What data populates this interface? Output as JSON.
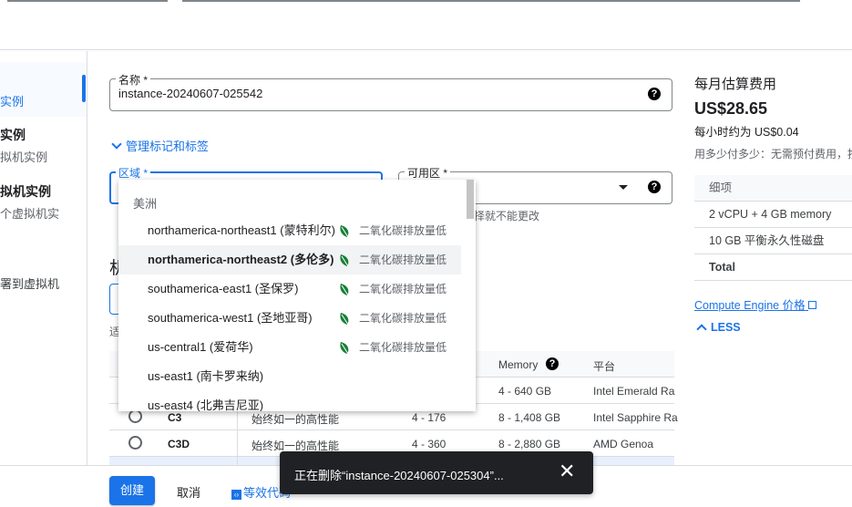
{
  "sidebar": {
    "items": [
      {
        "title": "",
        "subtitle": "实例"
      },
      {
        "title": "实例",
        "subtitle": "拟机实例"
      },
      {
        "title": "拟机实例",
        "subtitle": "个虚拟机实"
      },
      {
        "title": "",
        "subtitle": "署到虚拟机"
      }
    ]
  },
  "form": {
    "name_label": "名称 *",
    "name_value": "instance-20240607-025542",
    "manage_tags": "管理标记和标签",
    "region_label": "区域 *",
    "zone_label": "可用区 *",
    "zone_hint": "择就不能更改",
    "machine_heading_partial": "机",
    "hint_partial": "适"
  },
  "region_dropdown": {
    "group": "美洲",
    "items": [
      {
        "label": "northamerica-northeast1 (蒙特利尔)",
        "eco": "二氧化碳排放量低",
        "highlighted": false
      },
      {
        "label": "northamerica-northeast2 (多伦多)",
        "eco": "二氧化碳排放量低",
        "highlighted": true
      },
      {
        "label": "southamerica-east1 (圣保罗)",
        "eco": "二氧化碳排放量低",
        "highlighted": false
      },
      {
        "label": "southamerica-west1 (圣地亚哥)",
        "eco": "二氧化碳排放量低",
        "highlighted": false
      },
      {
        "label": "us-central1 (爱荷华)",
        "eco": "二氧化碳排放量低",
        "highlighted": false
      },
      {
        "label": "us-east1 (南卡罗来纳)",
        "eco": "",
        "highlighted": false
      },
      {
        "label": "us-east4 (北弗吉尼亚)",
        "eco": "",
        "highlighted": false
      }
    ],
    "leaf_color": "#188038"
  },
  "machine_table": {
    "headers": {
      "memory": "Memory",
      "platform": "平台"
    },
    "rows": [
      {
        "series": "",
        "desc": "",
        "vcpu": "",
        "memory": "4 - 640 GB",
        "platform": "Intel Emerald Ra"
      },
      {
        "series": "C3",
        "desc": "始终如一的高性能",
        "vcpu": "4 - 176",
        "memory": "8 - 1,408 GB",
        "platform": "Intel Sapphire Ra"
      },
      {
        "series": "C3D",
        "desc": "始终如一的高性能",
        "vcpu": "4 - 360",
        "memory": "8 - 2,880 GB",
        "platform": "AMD Genoa"
      }
    ]
  },
  "pricing": {
    "title": "每月估算费用",
    "monthly": "US$28.65",
    "hourly": "每小时约为 US$0.04",
    "note": "用多少付多少：无需预付费用，按",
    "header": "细项",
    "items": [
      "2 vCPU + 4 GB memory",
      "10 GB 平衡永久性磁盘",
      "Total"
    ],
    "link": "Compute Engine 价格",
    "less": "LESS"
  },
  "actions": {
    "create": "创建",
    "cancel": "取消",
    "equivalent_code": "等效代码"
  },
  "toast": {
    "message": "正在删除“instance-20240607-025304”..."
  },
  "colors": {
    "accent": "#1a73e8",
    "toast_bg": "#202124"
  }
}
